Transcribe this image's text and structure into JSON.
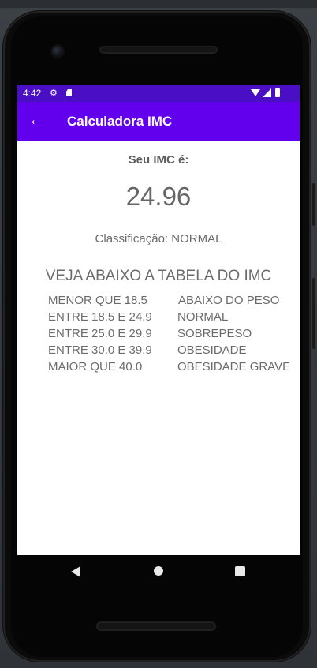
{
  "status_bar": {
    "time": "4:42",
    "icons": [
      "settings-icon",
      "sd-card-icon",
      "wifi-icon",
      "signal-icon",
      "battery-icon"
    ]
  },
  "app_bar": {
    "title": "Calculadora IMC",
    "back_icon": "arrow-left-icon",
    "color": "#6200ee",
    "status_color": "#4a0fc4"
  },
  "result": {
    "label": "Seu IMC é:",
    "value": "24.96",
    "classification": "Classificação: NORMAL"
  },
  "table": {
    "title": "VEJA ABAIXO A TABELA DO IMC",
    "rows": [
      {
        "range": "MENOR QUE 18.5",
        "category": "ABAIXO DO PESO"
      },
      {
        "range": "ENTRE 18.5 E 24.9",
        "category": "NORMAL"
      },
      {
        "range": "ENTRE 25.0 E 29.9",
        "category": "SOBREPESO"
      },
      {
        "range": "ENTRE 30.0 E 39.9",
        "category": "OBESIDADE"
      },
      {
        "range": "MAIOR QUE 40.0",
        "category": "OBESIDADE GRAVE"
      }
    ]
  },
  "nav_bar": {
    "icons": [
      "nav-back-icon",
      "nav-home-icon",
      "nav-recents-icon"
    ]
  }
}
